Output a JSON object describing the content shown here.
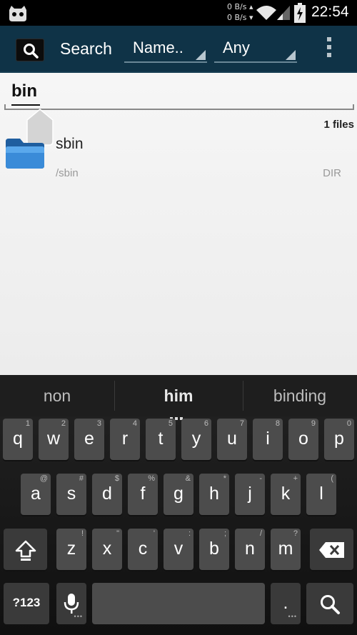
{
  "status_bar": {
    "net_up": "0 B/s",
    "net_down": "0 B/s",
    "time": "22:54"
  },
  "action_bar": {
    "title": "Search",
    "sort_spinner": "Name..",
    "type_spinner": "Any"
  },
  "search": {
    "query": "bin",
    "result_count": "1 files"
  },
  "results": [
    {
      "name": "sbin",
      "path": "/sbin",
      "type": "DIR"
    }
  ],
  "keyboard": {
    "suggestions": [
      "non",
      "him",
      "binding"
    ],
    "row1": [
      {
        "k": "q",
        "h": "1"
      },
      {
        "k": "w",
        "h": "2"
      },
      {
        "k": "e",
        "h": "3"
      },
      {
        "k": "r",
        "h": "4"
      },
      {
        "k": "t",
        "h": "5"
      },
      {
        "k": "y",
        "h": "6"
      },
      {
        "k": "u",
        "h": "7"
      },
      {
        "k": "i",
        "h": "8"
      },
      {
        "k": "o",
        "h": "9"
      },
      {
        "k": "p",
        "h": "0"
      }
    ],
    "row2": [
      {
        "k": "a",
        "h": "@"
      },
      {
        "k": "s",
        "h": "#"
      },
      {
        "k": "d",
        "h": "$"
      },
      {
        "k": "f",
        "h": "%"
      },
      {
        "k": "g",
        "h": "&"
      },
      {
        "k": "h",
        "h": "*"
      },
      {
        "k": "j",
        "h": "-"
      },
      {
        "k": "k",
        "h": "+"
      },
      {
        "k": "l",
        "h": "("
      }
    ],
    "row3": [
      {
        "k": "z",
        "h": "!"
      },
      {
        "k": "x",
        "h": "\""
      },
      {
        "k": "c",
        "h": "'"
      },
      {
        "k": "v",
        "h": ":"
      },
      {
        "k": "b",
        "h": ";"
      },
      {
        "k": "n",
        "h": "/"
      },
      {
        "k": "m",
        "h": "?"
      }
    ],
    "symbols_key": "?123",
    "period_key": ".",
    "icons": {
      "shift": "shift-icon",
      "backspace": "backspace-icon",
      "mic": "mic-icon",
      "search": "search-icon"
    }
  }
}
